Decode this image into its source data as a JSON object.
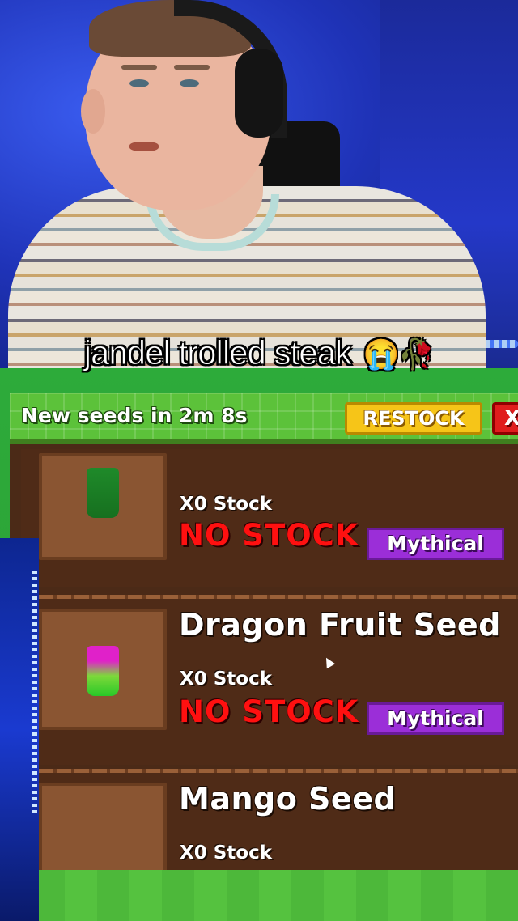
{
  "caption": {
    "text": "jandel trolled steak",
    "emoji": "😭🥀"
  },
  "shop": {
    "restock_timer": "New seeds in 2m 8s",
    "restock_button": "RESTOCK",
    "close_button": "X",
    "items": [
      {
        "name": "",
        "stock": "X0 Stock",
        "status": "NO STOCK",
        "rarity": "Mythical"
      },
      {
        "name": "Dragon Fruit Seed",
        "stock": "X0 Stock",
        "status": "NO STOCK",
        "rarity": "Mythical"
      },
      {
        "name": "Mango Seed",
        "stock": "X0 Stock"
      }
    ]
  },
  "colors": {
    "rarity_mythical": "#9b2ed8",
    "no_stock": "#ff1010",
    "restock": "#f6c518",
    "close": "#e01d1d",
    "header_green": "#5cc23a"
  }
}
